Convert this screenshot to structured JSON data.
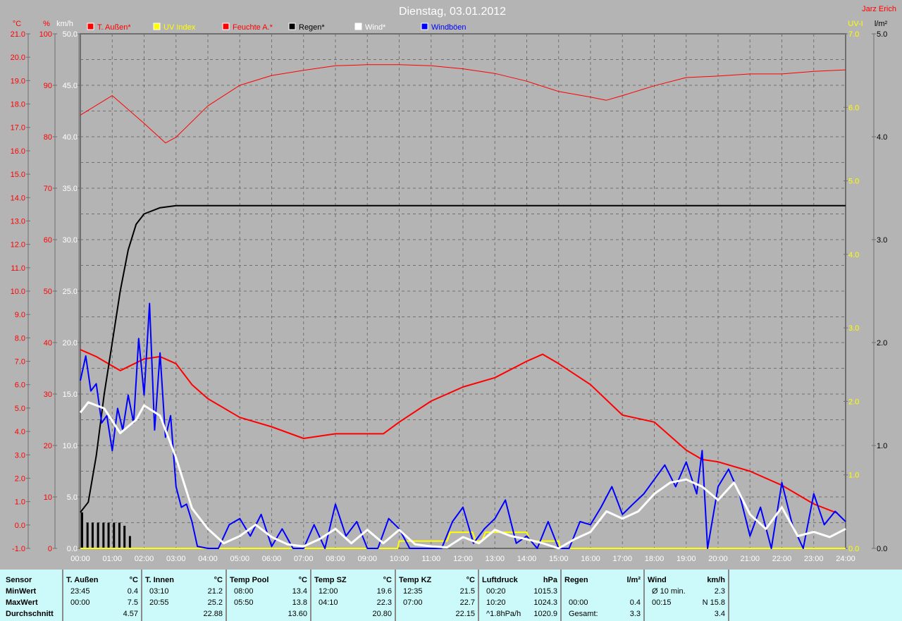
{
  "header": {
    "title": "Dienstag, 03.01.2012",
    "user": "Jarz Erich"
  },
  "colors": {
    "temp": "#ff0000",
    "uv": "#ffff00",
    "humidity": "#ff0000",
    "rain": "#000000",
    "wind": "#ffffff",
    "gust": "#0000ff",
    "bg": "#b4b4b4",
    "grid": "#7a7a7a"
  },
  "chart_data": {
    "type": "line",
    "title": "Dienstag, 03.01.2012",
    "legend": [
      {
        "label": "T. Außen*",
        "color": "#ff0000"
      },
      {
        "label": "UV Index",
        "color": "#ffff00"
      },
      {
        "label": "Feuchte A.*",
        "color": "#ff0000"
      },
      {
        "label": "Regen*",
        "color": "#000000"
      },
      {
        "label": "Wind*",
        "color": "#ffffff"
      },
      {
        "label": "Windböen",
        "color": "#0000ff"
      }
    ],
    "x_ticks": [
      "00:00",
      "01:00",
      "02:00",
      "03:00",
      "04:00",
      "05:00",
      "06:00",
      "07:00",
      "08:00",
      "09:00",
      "10:00",
      "11:00",
      "12:00",
      "13:00",
      "14:00",
      "15:00",
      "16:00",
      "17:00",
      "18:00",
      "19:00",
      "20:00",
      "21:00",
      "22:00",
      "23:00",
      "24:00"
    ],
    "axes": {
      "temp": {
        "unit": "°C",
        "range": [
          -1,
          21
        ],
        "ticks": [
          "21.0",
          "20.0",
          "19.0",
          "18.0",
          "17.0",
          "16.0",
          "15.0",
          "14.0",
          "13.0",
          "12.0",
          "11.0",
          "10.0",
          "9.0",
          "8.0",
          "7.0",
          "6.0",
          "5.0",
          "4.0",
          "3.0",
          "2.0",
          "1.0",
          "0.0",
          "-1.0"
        ]
      },
      "humidity": {
        "unit": "%",
        "range": [
          0,
          100
        ],
        "ticks": [
          "100",
          "90",
          "80",
          "70",
          "60",
          "50",
          "40",
          "30",
          "20",
          "10",
          "0"
        ]
      },
      "wind": {
        "unit": "km/h",
        "range": [
          0,
          50
        ],
        "ticks": [
          "50.0",
          "45.0",
          "40.0",
          "35.0",
          "30.0",
          "25.0",
          "20.0",
          "15.0",
          "10.0",
          "5.0",
          "0.0"
        ]
      },
      "uv": {
        "unit": "UV-I",
        "range": [
          0,
          7
        ],
        "ticks": [
          "7.0",
          "6.0",
          "5.0",
          "4.0",
          "3.0",
          "2.0",
          "1.0",
          "0.0"
        ]
      },
      "rain": {
        "unit": "l/m²",
        "range": [
          0,
          5
        ],
        "ticks": [
          "5.0",
          "4.0",
          "3.0",
          "2.0",
          "1.0",
          "0.0"
        ]
      }
    },
    "series": [
      {
        "name": "T. Außen",
        "axis": "temp",
        "color": "#ff0000",
        "width": 2,
        "x": [
          0,
          0.5,
          1.25,
          2,
          2.5,
          3,
          3.5,
          4,
          5,
          6,
          7,
          8,
          9,
          9.5,
          10,
          11,
          12,
          13,
          14,
          14.5,
          15,
          16,
          17,
          18,
          19,
          19.5,
          20,
          21,
          22,
          23,
          23.75
        ],
        "y": [
          7.5,
          7.2,
          6.6,
          7.1,
          7.2,
          6.9,
          6.0,
          5.4,
          4.6,
          4.2,
          3.7,
          3.9,
          3.9,
          3.9,
          4.4,
          5.3,
          5.9,
          6.3,
          7.0,
          7.3,
          6.9,
          6.0,
          4.7,
          4.4,
          3.2,
          2.8,
          2.7,
          2.3,
          1.7,
          0.9,
          0.5
        ]
      },
      {
        "name": "Feuchte A.",
        "axis": "humidity",
        "color": "#ff0000",
        "width": 1,
        "x": [
          0,
          1,
          2,
          2.67,
          3,
          4,
          5,
          6,
          7,
          8,
          9,
          10,
          11,
          12,
          13,
          14,
          15,
          16,
          16.5,
          17,
          18,
          19,
          20,
          21,
          22,
          23,
          24
        ],
        "y": [
          84.2,
          88,
          82.6,
          78.8,
          79.9,
          86,
          90,
          91.9,
          92.9,
          93.8,
          94,
          94,
          93.8,
          93.2,
          92.3,
          90.8,
          88.8,
          87.7,
          87.1,
          88,
          89.9,
          91.5,
          91.8,
          92.2,
          92.2,
          92.7,
          93
        ]
      },
      {
        "name": "Regen",
        "axis": "rain",
        "color": "#000000",
        "width": 2,
        "x": [
          0,
          0.25,
          0.5,
          0.75,
          1,
          1.25,
          1.5,
          1.75,
          2,
          2.5,
          3,
          24
        ],
        "y": [
          0.35,
          0.45,
          0.9,
          1.5,
          2.0,
          2.5,
          2.9,
          3.15,
          3.25,
          3.31,
          3.33,
          3.33
        ]
      },
      {
        "name": "UV Index",
        "axis": "uv",
        "color": "#ffff00",
        "width": 2,
        "x": [
          0,
          9.95,
          10,
          11.5,
          11.6,
          12.3,
          12.4,
          12.6,
          12.7,
          14,
          14.1,
          15,
          15.05,
          24
        ],
        "y": [
          0,
          0,
          0.1,
          0.1,
          0.22,
          0.22,
          0.1,
          0.1,
          0.22,
          0.22,
          0.1,
          0.1,
          0,
          0
        ]
      },
      {
        "name": "Windböen",
        "axis": "wind",
        "color": "#0000ff",
        "width": 2,
        "x": [
          0,
          0.17,
          0.33,
          0.5,
          0.67,
          0.83,
          1,
          1.17,
          1.33,
          1.5,
          1.67,
          1.83,
          2,
          2.17,
          2.33,
          2.5,
          2.67,
          2.83,
          3,
          3.17,
          3.33,
          3.5,
          3.67,
          4,
          4.33,
          4.67,
          5,
          5.33,
          5.67,
          6,
          6.33,
          6.67,
          7,
          7.33,
          7.67,
          8,
          8.33,
          8.67,
          9,
          9.33,
          9.67,
          10,
          10.33,
          10.67,
          11,
          11.33,
          11.67,
          12,
          12.33,
          12.67,
          13,
          13.33,
          13.67,
          14,
          14.33,
          14.67,
          15,
          15.33,
          15.67,
          16,
          16.33,
          16.67,
          17,
          17.33,
          17.67,
          18,
          18.33,
          18.67,
          19,
          19.33,
          19.5,
          19.67,
          20,
          20.33,
          20.67,
          21,
          21.33,
          21.67,
          22,
          22.33,
          22.67,
          23,
          23.33,
          23.67,
          24
        ],
        "y": [
          16.3,
          18.7,
          15.3,
          16,
          12.2,
          12.9,
          9.5,
          13.6,
          11.5,
          14.9,
          12.2,
          20.4,
          14.9,
          23.8,
          11.5,
          19,
          10.8,
          12.9,
          6,
          4,
          4.3,
          2.6,
          0.2,
          0,
          0,
          2.3,
          2.9,
          1.2,
          3.3,
          0.2,
          1.9,
          0,
          0,
          2.3,
          0,
          4.3,
          1.2,
          2.6,
          0,
          0,
          2.9,
          1.9,
          0,
          0,
          0,
          0,
          2.6,
          4,
          0.5,
          1.9,
          2.9,
          4.7,
          0.5,
          1.2,
          0,
          2.6,
          0,
          0,
          2.6,
          2.3,
          4,
          6,
          3.3,
          4.3,
          5.3,
          6.7,
          8.1,
          6,
          8.4,
          5.3,
          9.5,
          0,
          6,
          7.7,
          5.3,
          1.2,
          4,
          0,
          6.4,
          2.3,
          0,
          5.3,
          2.3,
          3.6,
          2.6
        ]
      },
      {
        "name": "Wind",
        "axis": "wind",
        "color": "#ffffff",
        "width": 3,
        "x": [
          0,
          0.25,
          0.75,
          1.25,
          1.75,
          2,
          2.5,
          3,
          3.5,
          4,
          4.5,
          5,
          5.5,
          6,
          6.5,
          7,
          7.5,
          8,
          8.5,
          9,
          9.5,
          10,
          10.5,
          11,
          11.5,
          12,
          12.5,
          13,
          13.5,
          14,
          14.5,
          15,
          15.5,
          16,
          16.5,
          17,
          17.5,
          18,
          18.5,
          19,
          19.5,
          20,
          20.5,
          21,
          21.5,
          22,
          22.5,
          23,
          23.5,
          24
        ],
        "y": [
          13.2,
          14.2,
          13.6,
          11.2,
          12.5,
          13.9,
          12.9,
          8.8,
          3.9,
          1.9,
          0.5,
          1.2,
          2.3,
          1.1,
          0.4,
          0.2,
          0.9,
          1.9,
          0.5,
          1.8,
          0.5,
          1.8,
          0.4,
          0.2,
          0.1,
          1.1,
          0.5,
          1.8,
          1.2,
          0.9,
          0.5,
          0,
          0.9,
          1.6,
          3.6,
          2.9,
          3.6,
          5.3,
          6.4,
          6.7,
          6,
          4.7,
          6.4,
          3.3,
          1.9,
          4,
          1.2,
          1.6,
          1.1,
          1.9
        ]
      }
    ],
    "rain_bars": {
      "axis": "rain",
      "x": [
        0,
        0.17,
        0.33,
        0.5,
        0.67,
        0.83,
        1,
        1.17,
        1.33,
        1.5
      ],
      "y": [
        0.35,
        0.25,
        0.25,
        0.25,
        0.25,
        0.25,
        0.25,
        0.25,
        0.22,
        0.12
      ]
    }
  },
  "table": {
    "row_labels": [
      "Sensor",
      "MinWert",
      "MaxWert",
      "Durchschnitt"
    ],
    "columns": [
      {
        "name": "T. Außen",
        "unit": "°C",
        "min_time": "23:45",
        "min": "0.4",
        "max_time": "00:00",
        "max": "7.5",
        "avg_label": "",
        "avg": "4.57"
      },
      {
        "name": "T. Innen",
        "unit": "°C",
        "min_time": "03:10",
        "min": "21.2",
        "max_time": "20:55",
        "max": "25.2",
        "avg_label": "",
        "avg": "22.88"
      },
      {
        "name": "Temp Pool",
        "unit": "°C",
        "min_time": "08:00",
        "min": "13.4",
        "max_time": "05:50",
        "max": "13.8",
        "avg_label": "",
        "avg": "13.60"
      },
      {
        "name": "Temp SZ",
        "unit": "°C",
        "min_time": "12:00",
        "min": "19.6",
        "max_time": "04:10",
        "max": "22.3",
        "avg_label": "",
        "avg": "20.80"
      },
      {
        "name": "Temp KZ",
        "unit": "°C",
        "min_time": "12:35",
        "min": "21.5",
        "max_time": "07:00",
        "max": "22.7",
        "avg_label": "",
        "avg": "22.15"
      },
      {
        "name": "Luftdruck",
        "unit": "hPa",
        "min_time": "00:20",
        "min": "1015.3",
        "max_time": "10:20",
        "max": "1024.3",
        "avg_label": "^1.8hPa/h",
        "avg": "1020.9"
      },
      {
        "name": "Regen",
        "unit": "l/m²",
        "min_time": "",
        "min": "",
        "max_time": "00:00",
        "max": "0.4",
        "avg_label": "Gesamt:",
        "avg": "3.3"
      },
      {
        "name": "Wind",
        "unit": "km/h",
        "min_time": "Ø 10 min.",
        "min": "2.3",
        "max_time": "00:15",
        "max": "N 15.8",
        "avg_label": "",
        "avg": "3.4"
      }
    ]
  }
}
